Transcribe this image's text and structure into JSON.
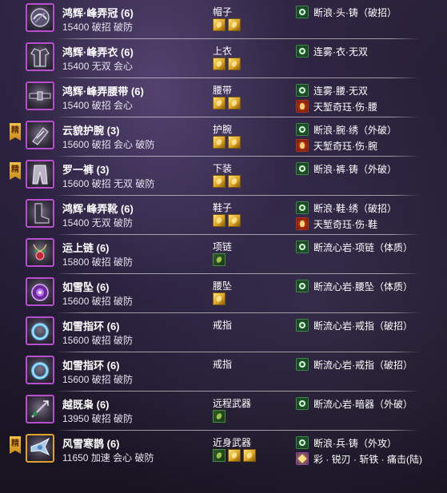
{
  "items": [
    {
      "tag": "",
      "name": "鸿辉·峰弄冠 (6)",
      "stats": "15400 破招 破防",
      "slot": "帽子",
      "gems": [
        "gold",
        "gold"
      ],
      "icon": "helmet-icon",
      "enchants": [
        {
          "icon": "green",
          "text": "断浪·头·铸（破招）"
        }
      ]
    },
    {
      "tag": "",
      "name": "鸿辉·峰弄衣 (6)",
      "stats": "15400 无双 会心",
      "slot": "上衣",
      "gems": [
        "gold",
        "gold"
      ],
      "icon": "robe-icon",
      "enchants": [
        {
          "icon": "green",
          "text": "连雾·衣·无双"
        }
      ]
    },
    {
      "tag": "",
      "name": "鸿辉·峰弄腰带 (6)",
      "stats": "15400 破招 会心",
      "slot": "腰带",
      "gems": [
        "gold",
        "gold"
      ],
      "icon": "belt-icon",
      "enchants": [
        {
          "icon": "green",
          "text": "连雾·腰·无双"
        },
        {
          "icon": "red",
          "text": "天堑奇珏·伤·腰"
        }
      ]
    },
    {
      "tag": "精",
      "name": "云貌护腕 (3)",
      "stats": "15600 破招 会心 破防",
      "slot": "护腕",
      "gems": [
        "gold",
        "gold"
      ],
      "icon": "bracer-icon",
      "enchants": [
        {
          "icon": "green",
          "text": "断浪·腕·绣（外破）"
        },
        {
          "icon": "red",
          "text": "天堑奇珏·伤·腕"
        }
      ]
    },
    {
      "tag": "精",
      "name": "罗一裤 (3)",
      "stats": "15600 破招 无双 破防",
      "slot": "下装",
      "gems": [
        "gold",
        "gold"
      ],
      "icon": "pants-icon",
      "enchants": [
        {
          "icon": "green",
          "text": "断浪·裤·铸（外破）"
        }
      ]
    },
    {
      "tag": "",
      "name": "鸿辉·峰弄靴 (6)",
      "stats": "15400 无双 破防",
      "slot": "鞋子",
      "gems": [
        "gold",
        "gold"
      ],
      "icon": "boots-icon",
      "enchants": [
        {
          "icon": "green",
          "text": "断浪·鞋·绣（破招）"
        },
        {
          "icon": "red",
          "text": "天堑奇珏·伤·鞋"
        }
      ]
    },
    {
      "tag": "",
      "name": "运上链 (6)",
      "stats": "15800 破招 破防",
      "slot": "项链",
      "gems": [
        "green"
      ],
      "icon": "necklace-icon",
      "enchants": [
        {
          "icon": "green",
          "text": "断流心岩·项链（体质）"
        }
      ]
    },
    {
      "tag": "",
      "name": "如雪坠 (6)",
      "stats": "15600 破招 破防",
      "slot": "腰坠",
      "gems": [
        "gold"
      ],
      "icon": "pendant-icon",
      "enchants": [
        {
          "icon": "green",
          "text": "断流心岩·腰坠（体质）"
        }
      ]
    },
    {
      "tag": "",
      "name": "如雪指环 (6)",
      "stats": "15600 破招 破防",
      "slot": "戒指",
      "gems": [],
      "icon": "ring-icon",
      "enchants": [
        {
          "icon": "green",
          "text": "断流心岩·戒指（破招）"
        }
      ]
    },
    {
      "tag": "",
      "name": "如雪指环 (6)",
      "stats": "15600 破招 破防",
      "slot": "戒指",
      "gems": [],
      "icon": "ring-icon",
      "enchants": [
        {
          "icon": "green",
          "text": "断流心岩·戒指（破招）"
        }
      ]
    },
    {
      "tag": "",
      "name": "越既枭 (6)",
      "stats": "13950 破招 破防",
      "slot": "远程武器",
      "gems": [
        "green"
      ],
      "icon": "ranged-weapon-icon",
      "enchants": [
        {
          "icon": "green",
          "text": "断流心岩·暗器（外破）"
        }
      ]
    },
    {
      "tag": "精",
      "name": "风雪寒鹊 (6)",
      "stats": "11650 加速 会心 破防",
      "slot": "近身武器",
      "gems": [
        "green",
        "gold",
        "gold"
      ],
      "icon": "melee-weapon-icon",
      "enchants": [
        {
          "icon": "green",
          "text": "断浪·兵·铸（外攻）"
        },
        {
          "icon": "purple",
          "text": "彩 · 锐刃 · 斩铁 · 痛击(陆)"
        }
      ]
    }
  ],
  "colors": {
    "frame_purple": "#b84fd0",
    "frame_gold": "#e0a22c",
    "gem_gold": "#d99e1c",
    "enchant_green": "#2b6a3a",
    "enchant_red": "#d84a1a"
  }
}
